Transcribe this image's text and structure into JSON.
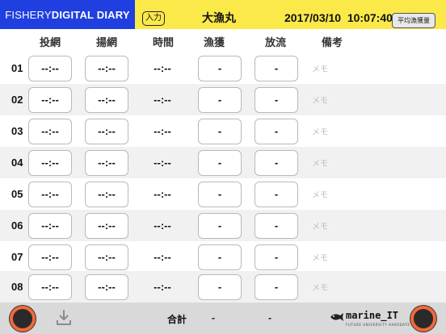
{
  "header": {
    "brand_light": "FISHERY ",
    "brand_bold": "DIGITAL DIARY",
    "mode_label": "入力",
    "ship_name": "大漁丸",
    "datetime": "2017/03/10  10:07:40",
    "avg_button": "平均漁獲量"
  },
  "columns": [
    "投網",
    "揚網",
    "時間",
    "漁獲",
    "放流",
    "備考"
  ],
  "rows": [
    {
      "num": "01",
      "cast": "--:--",
      "haul": "--:--",
      "time": "--:--",
      "catch": "-",
      "release": "-",
      "memo": "メモ"
    },
    {
      "num": "02",
      "cast": "--:--",
      "haul": "--:--",
      "time": "--:--",
      "catch": "-",
      "release": "-",
      "memo": "メモ"
    },
    {
      "num": "03",
      "cast": "--:--",
      "haul": "--:--",
      "time": "--:--",
      "catch": "-",
      "release": "-",
      "memo": "メモ"
    },
    {
      "num": "04",
      "cast": "--:--",
      "haul": "--:--",
      "time": "--:--",
      "catch": "-",
      "release": "-",
      "memo": "メモ"
    },
    {
      "num": "05",
      "cast": "--:--",
      "haul": "--:--",
      "time": "--:--",
      "catch": "-",
      "release": "-",
      "memo": "メモ"
    },
    {
      "num": "06",
      "cast": "--:--",
      "haul": "--:--",
      "time": "--:--",
      "catch": "-",
      "release": "-",
      "memo": "メモ"
    },
    {
      "num": "07",
      "cast": "--:--",
      "haul": "--:--",
      "time": "--:--",
      "catch": "-",
      "release": "-",
      "memo": "メモ"
    },
    {
      "num": "08",
      "cast": "--:--",
      "haul": "--:--",
      "time": "--:--",
      "catch": "-",
      "release": "-",
      "memo": "メモ"
    }
  ],
  "footer": {
    "total_label": "合計",
    "total_catch": "-",
    "total_release": "-",
    "logo_text": "marine_IT",
    "logo_subtext": "FUTURE UNIVERSITY HAKODATE"
  },
  "colors": {
    "brand_blue": "#1f3fe0",
    "header_yellow": "#fbe94a",
    "knob_orange": "#f2683a"
  },
  "icons": [
    "download-icon",
    "fish-logo-icon"
  ]
}
